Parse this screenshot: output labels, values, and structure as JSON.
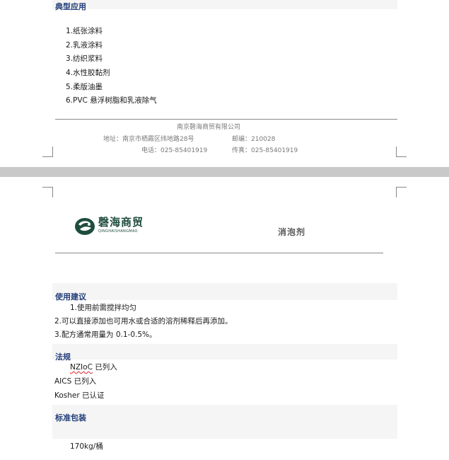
{
  "page1": {
    "section_title": "典型应用",
    "applications": [
      "1.纸张涂料",
      "2.乳液涂料",
      "3.纺织浆料",
      "4.水性胶黏剂",
      "5.柔版油墨",
      "6.PVC 悬浮树脂和乳液除气"
    ],
    "footer": {
      "company": "南京磬海商贸有限公司",
      "address": "地址：南京市栖霞区纬地路28号",
      "postcode": "邮编：210028",
      "phone": "电话：025-85401919",
      "fax": "传真：025-85401919"
    }
  },
  "page2": {
    "header": {
      "logo_name": "磬海商贸",
      "logo_sub": "QINGHAISHANGMAO",
      "doc_title": "消泡剂"
    },
    "usage": {
      "title": "使用建议",
      "items": [
        "1.使用前需搅拌均匀",
        "2.可以直接添加也可用水或合适的溶剂稀释后再添加。",
        "3.配方通常用量为 0.1-0.5%。"
      ]
    },
    "regulations": {
      "title": "法规",
      "nzioc_code": "NZIoC",
      "nzioc_status": " 已列入",
      "aics": "AICS 已列入",
      "kosher": "Kosher 已认证"
    },
    "packaging": {
      "title": "标准包装",
      "value": "170kg/桶"
    }
  },
  "colors": {
    "heading": "#243f7a",
    "logo": "#1e4d3d",
    "page_gap": "#c9c9c9"
  }
}
